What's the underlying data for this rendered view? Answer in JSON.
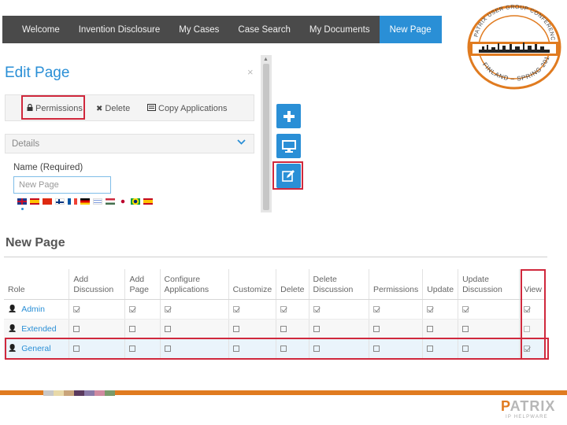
{
  "topnav": {
    "items": [
      "Welcome",
      "Invention Disclosure",
      "My Cases",
      "Case Search",
      "My Documents"
    ],
    "active": "New Page"
  },
  "stamp": {
    "top_text": "PATRIX USER GROUP CONFERENCE",
    "bottom_text": "FINLAND – SPRING 2013"
  },
  "edit_panel": {
    "title": "Edit Page",
    "close": "×",
    "toolbar": {
      "permissions": "Permissions",
      "delete": "Delete",
      "copy": "Copy Applications"
    },
    "details_label": "Details",
    "name_label": "Name (Required)",
    "name_value": "New Page",
    "flags": [
      "gb",
      "es",
      "cn",
      "fi",
      "fr",
      "de",
      "il",
      "hu",
      "jp",
      "br",
      "es2"
    ]
  },
  "section_title": "New Page",
  "grid": {
    "headers": [
      [
        "Role"
      ],
      [
        "Add",
        "Discussion"
      ],
      [
        "Add",
        "Page"
      ],
      [
        "Configure",
        "Applications"
      ],
      [
        "Customize"
      ],
      [
        "Delete"
      ],
      [
        "Delete",
        "Discussion"
      ],
      [
        "Permissions"
      ],
      [
        "Update"
      ],
      [
        "Update",
        "Discussion"
      ],
      [
        "View"
      ]
    ],
    "rows": [
      {
        "role": "Admin",
        "checks": [
          "checked",
          "checked",
          "checked",
          "checked",
          "checked",
          "checked",
          "checked",
          "checked",
          "checked",
          "checked"
        ]
      },
      {
        "role": "Extended",
        "checks": [
          "empty",
          "empty",
          "empty",
          "empty",
          "empty",
          "empty",
          "empty",
          "empty",
          "empty",
          "faint"
        ]
      },
      {
        "role": "General",
        "checks": [
          "empty",
          "empty",
          "empty",
          "empty",
          "empty",
          "empty",
          "empty",
          "empty",
          "empty",
          "checked"
        ]
      }
    ]
  },
  "footer": {
    "swatches": [
      "#c8c8c8",
      "#e8d9a8",
      "#c9a47a",
      "#5b3a5e",
      "#8a7aa8",
      "#d08aa0",
      "#7a9a6a"
    ],
    "logo_main_rest": "ATRIX",
    "logo_main_first": "P",
    "logo_sub": "IP HELPWARE"
  },
  "colors": {
    "accent": "#2a8fd6",
    "highlight": "#d0283c",
    "brand_orange": "#e07b20"
  }
}
